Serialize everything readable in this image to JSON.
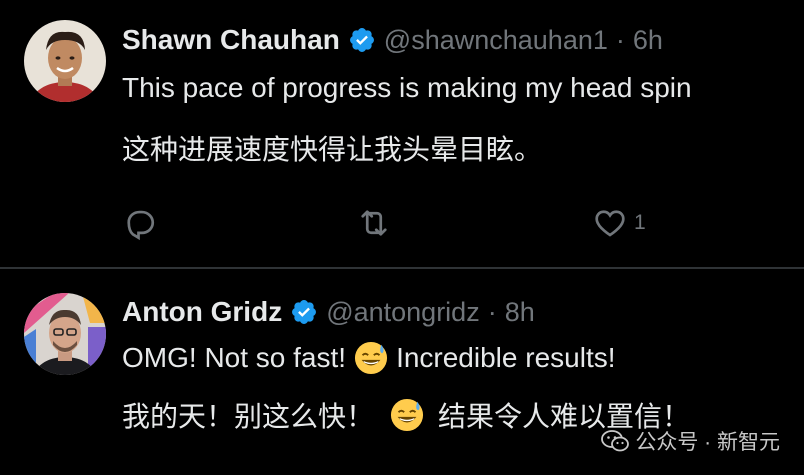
{
  "tweets": [
    {
      "author_name": "Shawn Chauhan",
      "handle": "@shawnchauhan1",
      "separator": "·",
      "time": "6h",
      "text_en": "This pace of progress is making my head spin",
      "text_zh": "这种进展速度快得让我头晕目眩。",
      "actions": {
        "reply_icon": "reply-icon",
        "retweet_icon": "retweet-icon",
        "like_icon": "heart-icon",
        "like_count": "1"
      }
    },
    {
      "author_name": "Anton Gridz",
      "handle": "@antongridz",
      "separator": "·",
      "time": "8h",
      "text_en_part1": "OMG! Not so fast!",
      "emoji": "grinning-face-with-sweat",
      "text_en_part2": "Incredible results!",
      "text_zh_part1": "我的天！别这么快！",
      "text_zh_part2": "结果令人难以置信！"
    }
  ],
  "watermark": {
    "icon": "wechat-icon",
    "text": "公众号 · 新智元"
  },
  "colors": {
    "background": "#000000",
    "primary_text": "#e7e9ea",
    "secondary_text": "#71767b",
    "verified": "#1d9bf0",
    "divider": "#2f3336"
  }
}
